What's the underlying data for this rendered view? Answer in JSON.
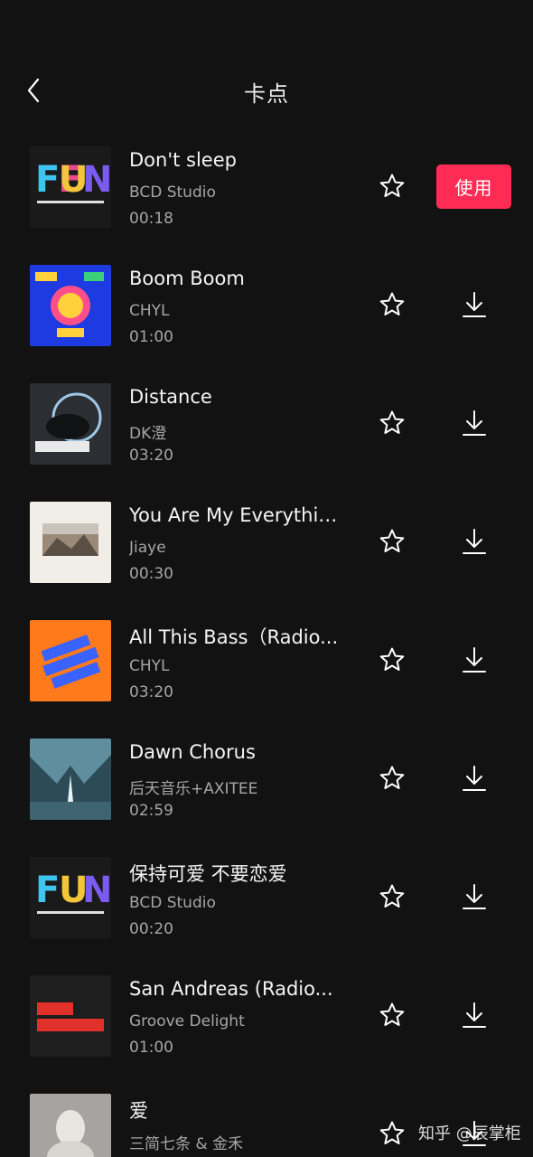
{
  "header": {
    "title": "卡点"
  },
  "actions": {
    "use_label": "使用"
  },
  "songs": [
    {
      "title": "Don't sleep",
      "artist": "BCD Studio",
      "duration": "00:18",
      "cover": "fun-cover",
      "selected": true
    },
    {
      "title": "Boom Boom",
      "artist": "CHYL",
      "duration": "01:00",
      "cover": "boom-cover"
    },
    {
      "title": "Distance",
      "artist": "DK澄",
      "duration": "03:20",
      "cover": "distance-cover"
    },
    {
      "title": "You Are My Everythin...",
      "artist": "Jiaye",
      "duration": "00:30",
      "cover": "landscape-cover"
    },
    {
      "title": "All This Bass（Radio...",
      "artist": "CHYL",
      "duration": "03:20",
      "cover": "bass-cover"
    },
    {
      "title": "Dawn Chorus",
      "artist": "后天音乐+AXITEE",
      "duration": "02:59",
      "cover": "mountain-cover"
    },
    {
      "title": "保持可爱 不要恋爱",
      "artist": "BCD Studio",
      "duration": "00:20",
      "cover": "fun-cover"
    },
    {
      "title": "San Andreas (Radio...",
      "artist": "Groove Delight",
      "duration": "01:00",
      "cover": "san-andreas-cover"
    },
    {
      "title": "爱",
      "artist": "三简七条 & 金禾",
      "duration": "",
      "cover": "sculpture-cover"
    }
  ],
  "watermark": "知乎 @辰掌柜",
  "colors": {
    "background": "#121212",
    "accent": "#fe2c55",
    "secondary_text": "#a6a6a6"
  }
}
